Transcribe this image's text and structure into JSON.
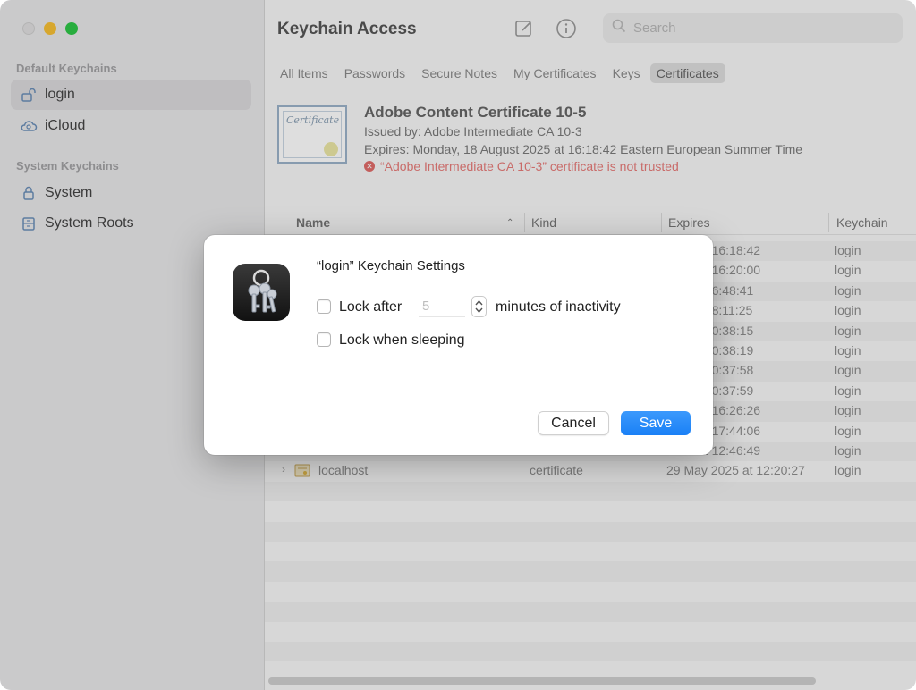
{
  "window": {
    "title": "Keychain Access"
  },
  "sidebar": {
    "sections": [
      {
        "label": "Default Keychains",
        "items": [
          {
            "label": "login",
            "icon": "lock-open-icon",
            "selected": true
          },
          {
            "label": "iCloud",
            "icon": "icloud-icon",
            "selected": false
          }
        ]
      },
      {
        "label": "System Keychains",
        "items": [
          {
            "label": "System",
            "icon": "lock-icon",
            "selected": false
          },
          {
            "label": "System Roots",
            "icon": "cabinet-icon",
            "selected": false
          }
        ]
      }
    ]
  },
  "toolbar": {
    "compose_icon": "compose-icon",
    "info_icon": "info-icon",
    "search_placeholder": "Search"
  },
  "tabs": [
    "All Items",
    "Passwords",
    "Secure Notes",
    "My Certificates",
    "Keys",
    "Certificates"
  ],
  "active_tab": "Certificates",
  "certificate": {
    "image_text": "Certificate",
    "name": "Adobe Content Certificate 10-5",
    "issued_by": "Issued by: Adobe Intermediate CA 10-3",
    "expires": "Expires: Monday, 18 August 2025 at 16:18:42 Eastern European Summer Time",
    "error": "“Adobe Intermediate CA 10-3” certificate is not trusted"
  },
  "table": {
    "columns": [
      "Name",
      "Kind",
      "Expires",
      "Keychain"
    ],
    "rows": [
      {
        "name": "",
        "kind": "",
        "expires": "2025 at 16:18:42",
        "keychain": "login"
      },
      {
        "name": "",
        "kind": "",
        "expires": "2025 at 16:20:00",
        "keychain": "login"
      },
      {
        "name": "",
        "kind": "",
        "expires": "030 at 16:48:41",
        "keychain": "login"
      },
      {
        "name": "",
        "kind": "",
        "expires": "030 at 18:11:25",
        "keychain": "login"
      },
      {
        "name": "",
        "kind": "",
        "expires": "068 at 20:38:15",
        "keychain": "login"
      },
      {
        "name": "",
        "kind": "",
        "expires": "068 at 20:38:19",
        "keychain": "login"
      },
      {
        "name": "",
        "kind": "",
        "expires": "068 at 20:37:58",
        "keychain": "login"
      },
      {
        "name": "",
        "kind": "",
        "expires": "068 at 20:37:59",
        "keychain": "login"
      },
      {
        "name": "",
        "kind": "",
        "expires": "2024 at 16:26:26",
        "keychain": "login"
      },
      {
        "name": "",
        "kind": "",
        "expires": "2024 at 17:44:06",
        "keychain": "login"
      },
      {
        "name": "",
        "kind": "",
        "expires": "2122 at 12:46:49",
        "keychain": "login"
      },
      {
        "name": "localhost",
        "kind": "certificate",
        "expires": "29 May 2025 at 12:20:27",
        "keychain": "login"
      }
    ]
  },
  "dialog": {
    "title": "“login” Keychain Settings",
    "lock_after_label": "Lock after",
    "lock_after_minutes": "5",
    "minutes_suffix": "minutes of inactivity",
    "lock_when_sleeping_label": "Lock when sleeping",
    "lock_after_checked": false,
    "lock_when_sleeping_checked": false,
    "cancel_label": "Cancel",
    "save_label": "Save"
  },
  "colors": {
    "accent": "#1a80f6",
    "error": "#e06c6a"
  }
}
